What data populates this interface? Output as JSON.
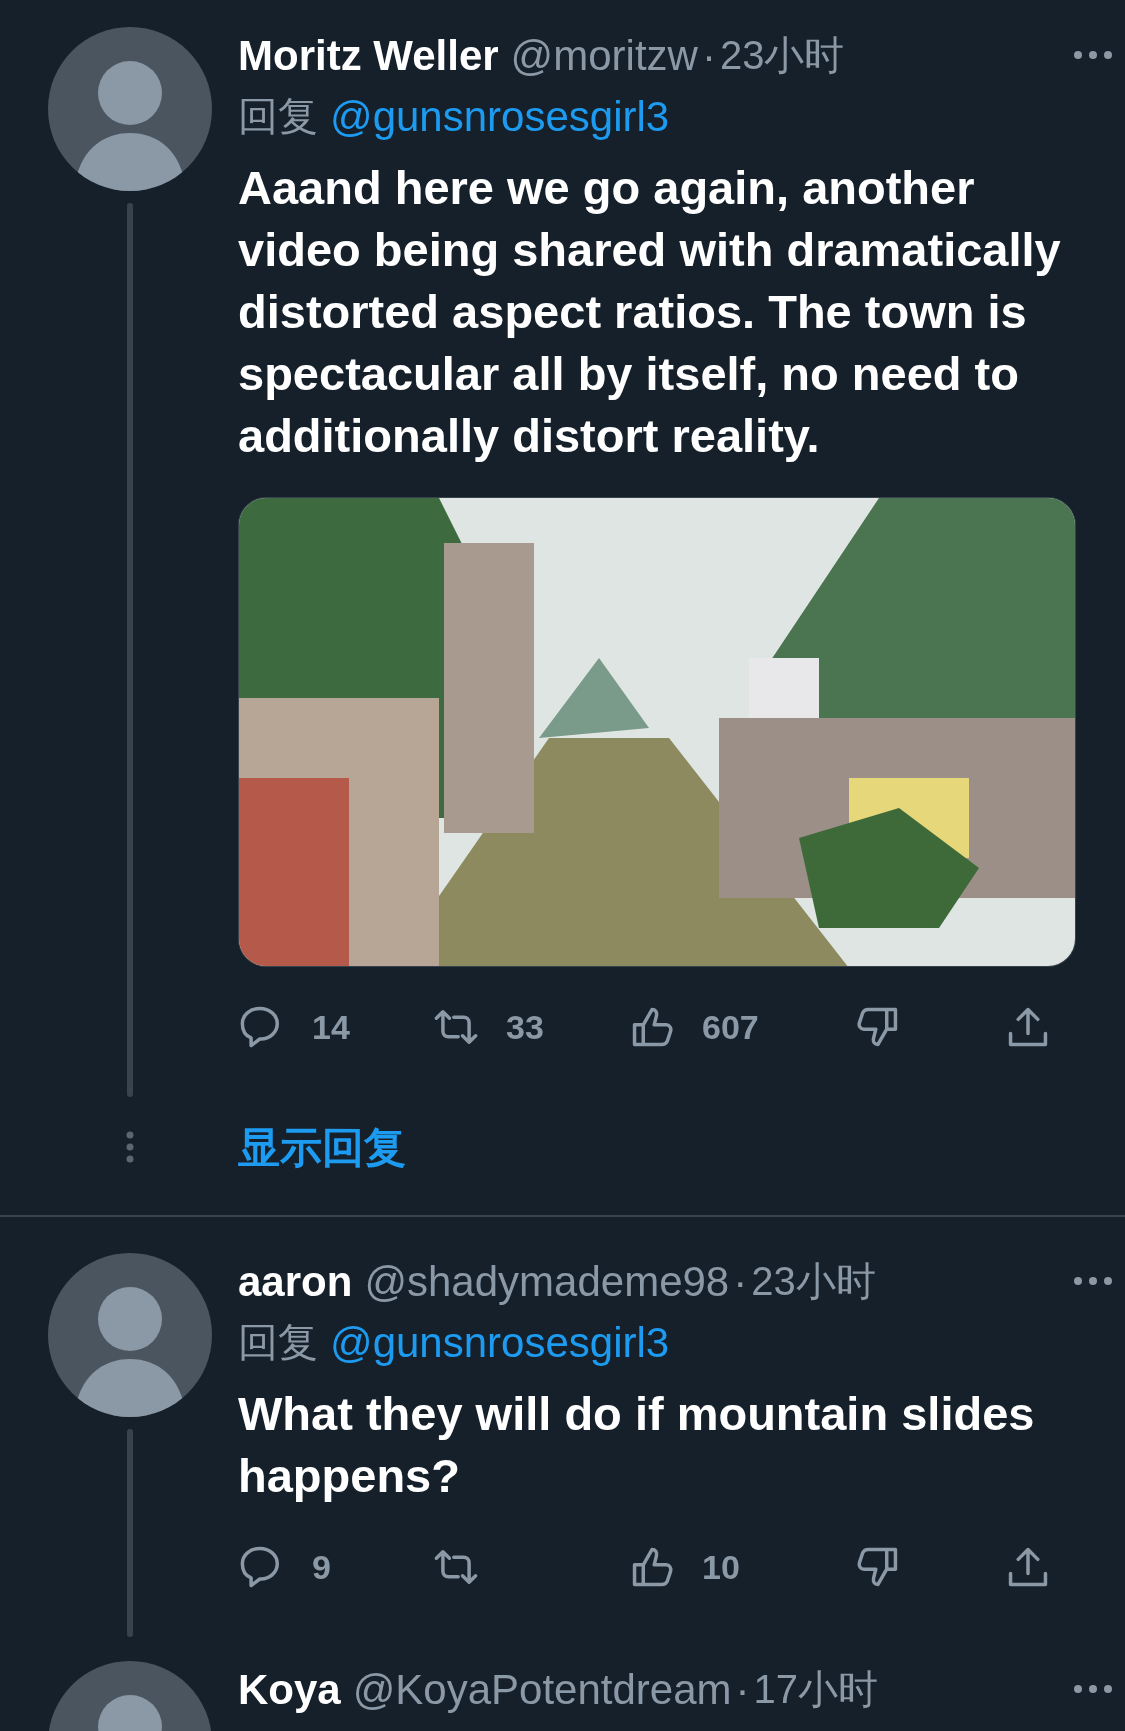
{
  "tweets": [
    {
      "name": "Moritz Weller",
      "handle": "@moritzw",
      "dot": "·",
      "time": "23小时",
      "reply_label": "回复",
      "reply_to": "@gunsnrosesgirl3",
      "text": "Aaand here we go again, another video being shared with dramatically distorted aspect ratios. The town is spectacular all by itself, no need to additionally distort reality.",
      "has_media": true,
      "actions": [
        {
          "kind": "reply",
          "count": "14"
        },
        {
          "kind": "retweet",
          "count": "33"
        },
        {
          "kind": "like",
          "count": "607"
        },
        {
          "kind": "dislike"
        },
        {
          "kind": "share"
        }
      ],
      "show_replies": "显示回复"
    },
    {
      "name": "aaron",
      "handle": "@shadymademe98",
      "dot": "·",
      "time": "23小时",
      "reply_label": "回复",
      "reply_to": "@gunsnrosesgirl3",
      "text": "What they will do if mountain slides happens?",
      "actions": [
        {
          "kind": "reply",
          "count": "9"
        },
        {
          "kind": "retweet"
        },
        {
          "kind": "like",
          "count": "10"
        },
        {
          "kind": "dislike"
        },
        {
          "kind": "share"
        }
      ]
    },
    {
      "name": "Koya",
      "handle": "@KoyaPotentdream",
      "dot": "·",
      "time": "17小时"
    }
  ]
}
